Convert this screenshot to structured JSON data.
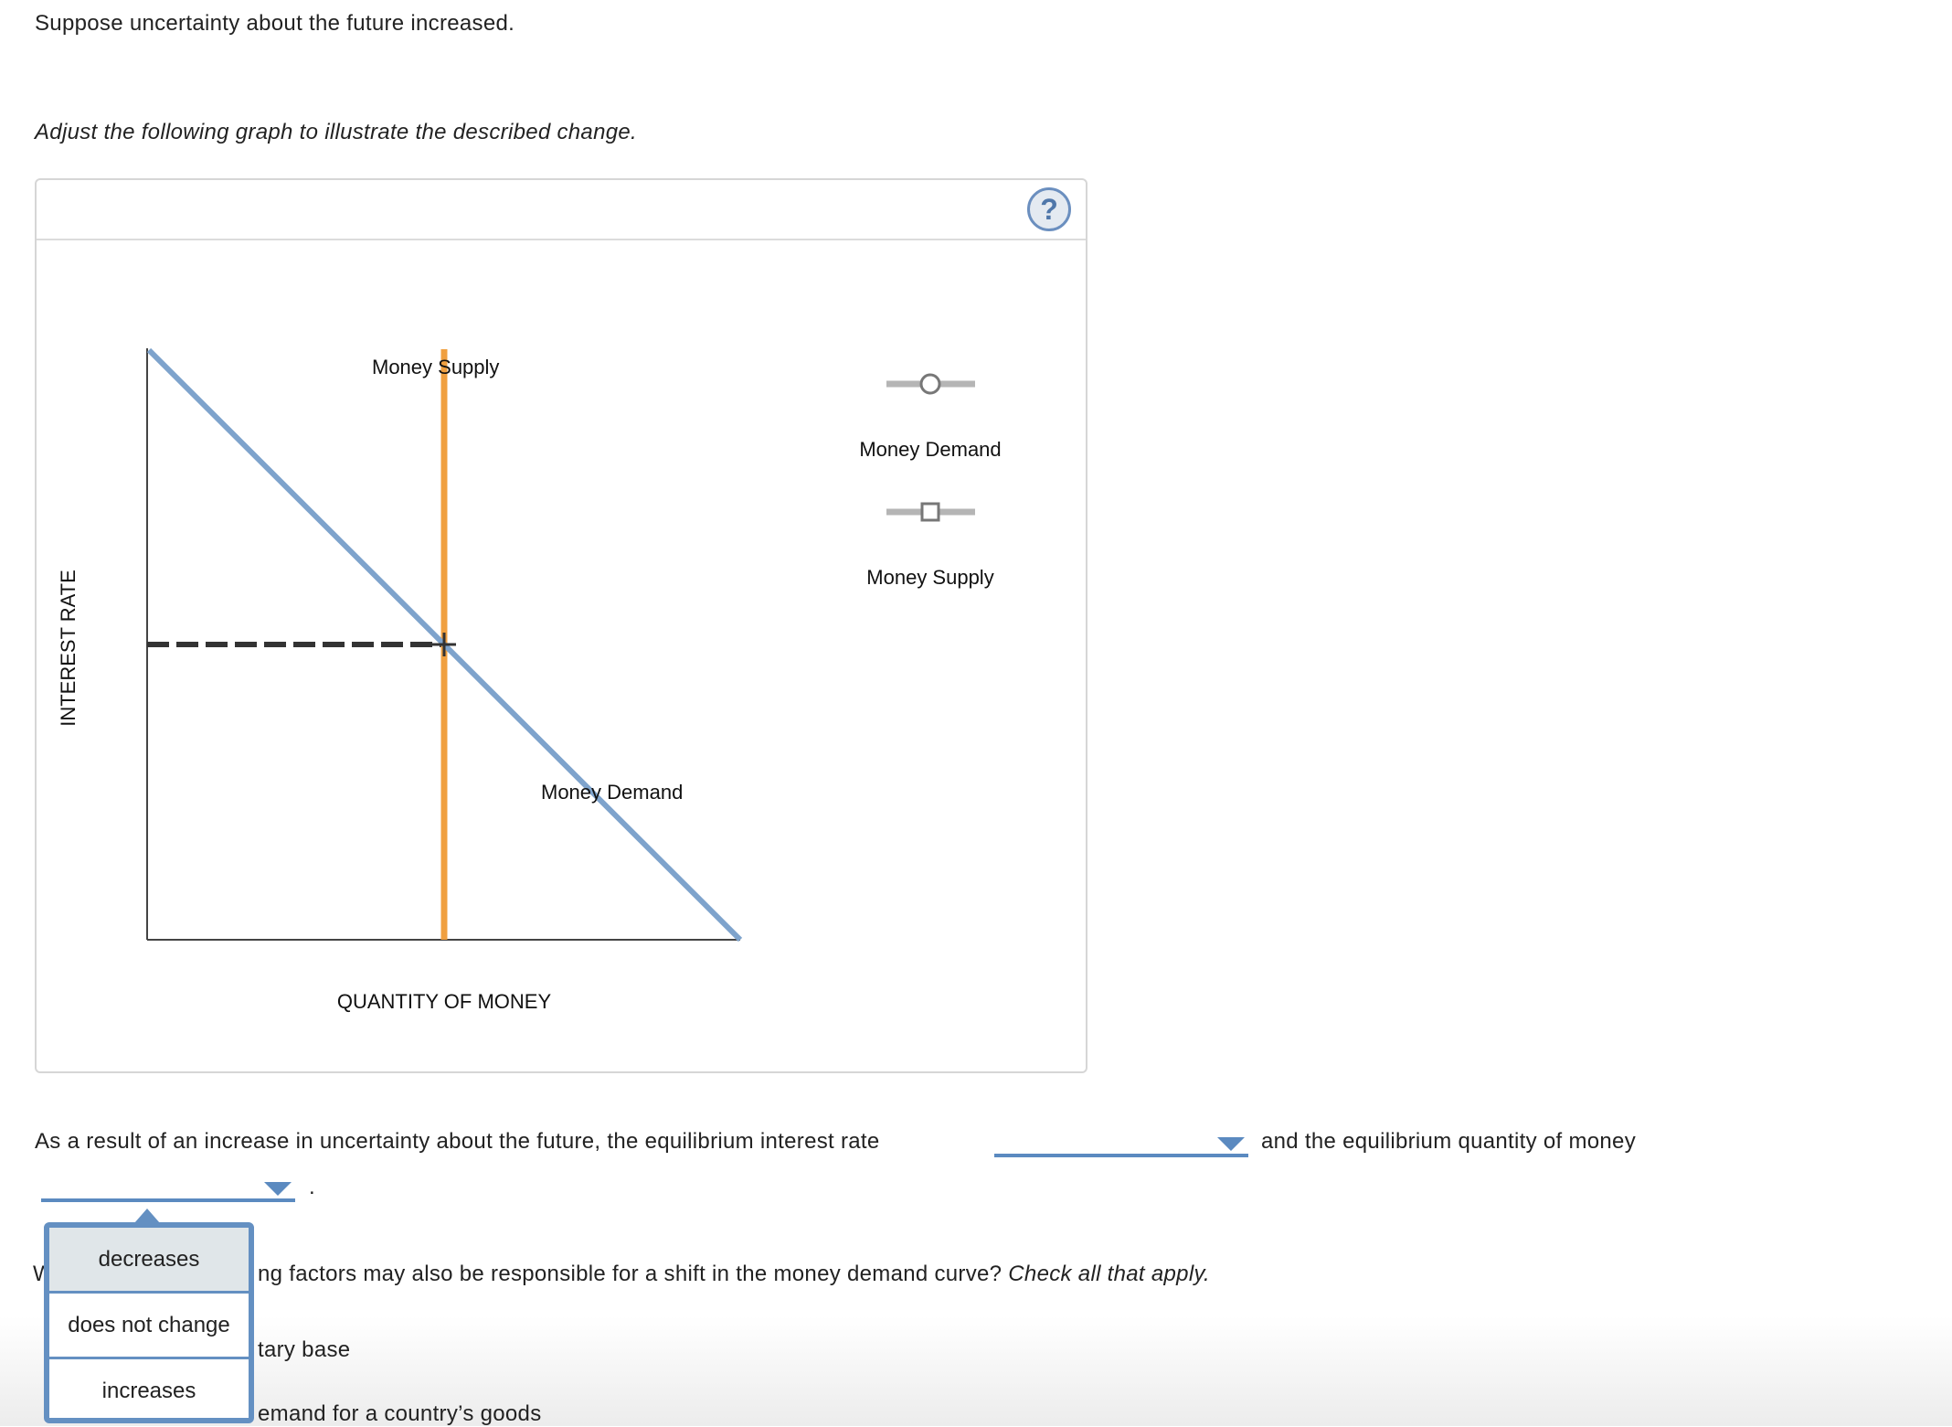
{
  "prompt": "Suppose uncertainty about the future increased.",
  "instruction": "Adjust the following graph to illustrate the described change.",
  "graph": {
    "help_icon": "question-circle-icon",
    "y_axis_label": "INTEREST RATE",
    "x_axis_label": "QUANTITY OF MONEY",
    "curves": [
      {
        "name": "Money Demand",
        "color": "#7ea3cc"
      },
      {
        "name": "Money Supply",
        "color": "#f0a040"
      }
    ],
    "palette": [
      {
        "label": "Money Demand",
        "handle": "circle"
      },
      {
        "label": "Money Supply",
        "handle": "square"
      }
    ]
  },
  "question1": {
    "text_before": "As a result of an increase in uncertainty about the future, the equilibrium interest rate",
    "text_middle": "and the equilibrium quantity of money",
    "text_end": ".",
    "dropdown1_value": "",
    "dropdown2_value": "",
    "dropdown_options": [
      "decreases",
      "does not change",
      "increases"
    ]
  },
  "question2": {
    "lead_fragment": "W",
    "text_visible": "ng factors may also be responsible for a shift in the money demand curve?",
    "text_italic": "Check all that apply.",
    "options_visible": [
      "tary base",
      "emand for a country’s goods"
    ]
  },
  "colors": {
    "accent": "#5b8ac0",
    "money_supply": "#f0a040",
    "money_demand": "#7ea3cc",
    "highlight": "#e0e6e9"
  }
}
